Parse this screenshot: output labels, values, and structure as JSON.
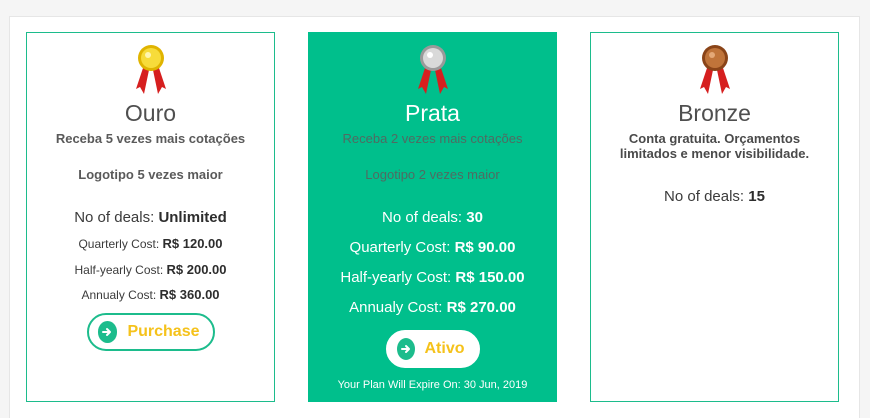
{
  "colors": {
    "accent": "#1cbc8c",
    "active_card": "#00bf8c",
    "button_text": "#f5c21b",
    "gold": "#f2d22e",
    "silver": "#c9c9c9",
    "bronze": "#b5652e",
    "ribbon": "#d61f1f"
  },
  "plans": [
    {
      "icon": "gold-medal-icon",
      "name": "Ouro",
      "tagline": "Receba 5 vezes mais cotações",
      "logo_text": "Logotipo 5 vezes maior",
      "deals_label": "No of deals:",
      "deals_value": "Unlimited",
      "quarterly_label": "Quarterly Cost:",
      "quarterly_value": "R$ 120.00",
      "halfyearly_label": "Half-yearly Cost:",
      "halfyearly_value": "R$ 200.00",
      "annual_label": "Annualy Cost:",
      "annual_value": "R$ 360.00",
      "button_label": "Purchase"
    },
    {
      "icon": "silver-medal-icon",
      "name": "Prata",
      "tagline": "Receba 2 vezes mais cotações",
      "logo_text": "Logotipo 2 vezes maior",
      "deals_label": "No of deals:",
      "deals_value": "30",
      "quarterly_label": "Quarterly Cost:",
      "quarterly_value": "R$ 90.00",
      "halfyearly_label": "Half-yearly Cost:",
      "halfyearly_value": "R$ 150.00",
      "annual_label": "Annualy Cost:",
      "annual_value": "R$ 270.00",
      "button_label": "Ativo",
      "expire_text": "Your Plan Will Expire On: 30 Jun, 2019"
    },
    {
      "icon": "bronze-medal-icon",
      "name": "Bronze",
      "tagline": "Conta gratuita. Orçamentos limitados e menor visibilidade.",
      "deals_label": "No of deals:",
      "deals_value": "15"
    }
  ]
}
